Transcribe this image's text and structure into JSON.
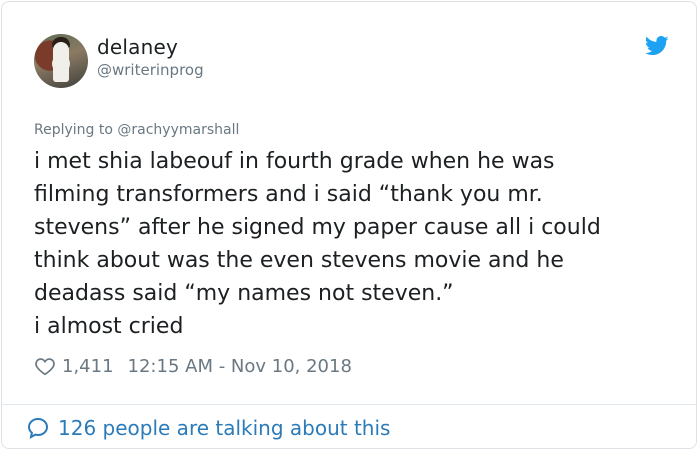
{
  "author": {
    "display_name": "delaney",
    "handle": "@writerinprog",
    "avatar_icon": "profile-photo"
  },
  "brand": {
    "icon": "twitter-bird-icon",
    "color": "#1da1f2"
  },
  "tweet": {
    "replying_to_prefix": "Replying to",
    "replying_to_handle": "@rachyymarshall",
    "text": "i met shia labeouf in fourth grade when he was\nfilming transformers and i said “thank you mr.\nstevens” after he signed my paper cause all i could\nthink about was the even stevens movie and he\ndeadass said “my names not steven.”\ni almost cried",
    "likes": "1,411",
    "timestamp": "12:15 AM - Nov 10, 2018"
  },
  "footer": {
    "label": "126 people are talking about this",
    "link_color": "#2b7bb9"
  }
}
